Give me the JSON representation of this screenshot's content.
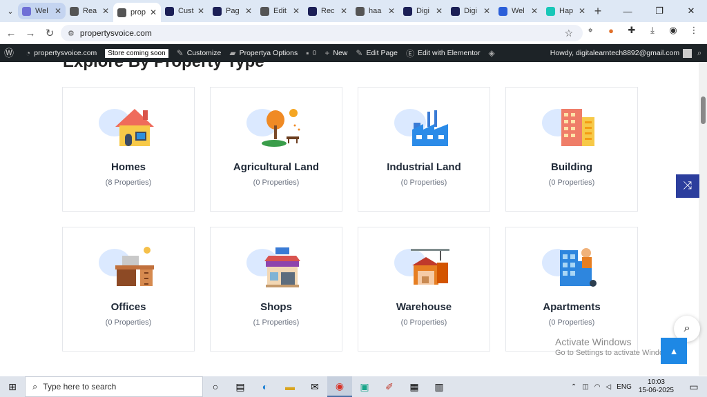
{
  "browser": {
    "tabs": [
      {
        "title": "Wel",
        "color": "#6f6fd6",
        "active": false,
        "highlight": true
      },
      {
        "title": "Rea",
        "color": "#555555",
        "active": false,
        "highlight": false
      },
      {
        "title": "prop",
        "color": "#555555",
        "active": true,
        "highlight": false
      },
      {
        "title": "Cust",
        "color": "#1b1f56",
        "active": false,
        "highlight": false
      },
      {
        "title": "Pag",
        "color": "#1b1f56",
        "active": false,
        "highlight": false
      },
      {
        "title": "Edit",
        "color": "#555555",
        "active": false,
        "highlight": false
      },
      {
        "title": "Rec",
        "color": "#1b1f56",
        "active": false,
        "highlight": false
      },
      {
        "title": "haa",
        "color": "#555555",
        "active": false,
        "highlight": false
      },
      {
        "title": "Digi",
        "color": "#1b1f56",
        "active": false,
        "highlight": false
      },
      {
        "title": "Digi",
        "color": "#1b1f56",
        "active": false,
        "highlight": false
      },
      {
        "title": "Wel",
        "color": "#2b5fd9",
        "active": false,
        "highlight": false
      },
      {
        "title": "Hap",
        "color": "#18c7b8",
        "active": false,
        "highlight": false
      }
    ],
    "address": "propertysvoice.com"
  },
  "adminbar": {
    "site": "propertysvoice.com",
    "store_badge": "Store coming soon",
    "customize": "Customize",
    "options": "Propertya Options",
    "comments": "0",
    "new": "New",
    "edit_page": "Edit Page",
    "elementor": "Edit with Elementor",
    "howdy": "Howdy, digitalearntech8892@gmail.com"
  },
  "section": {
    "heading": "Explore By Property Type"
  },
  "categories": [
    {
      "name": "Homes",
      "count": "(8 Properties)",
      "icon": "house-icon"
    },
    {
      "name": "Agricultural Land",
      "count": "(0 Properties)",
      "icon": "tree-icon"
    },
    {
      "name": "Industrial Land",
      "count": "(0 Properties)",
      "icon": "factory-icon"
    },
    {
      "name": "Building",
      "count": "(0 Properties)",
      "icon": "building-icon"
    },
    {
      "name": "Offices",
      "count": "(0 Properties)",
      "icon": "desk-icon"
    },
    {
      "name": "Shops",
      "count": "(1 Properties)",
      "icon": "shop-icon"
    },
    {
      "name": "Warehouse",
      "count": "(0 Properties)",
      "icon": "warehouse-icon"
    },
    {
      "name": "Apartments",
      "count": "(0 Properties)",
      "icon": "apartment-icon"
    }
  ],
  "watermark": {
    "line1": "Activate Windows",
    "line2": "Go to Settings to activate Windows."
  },
  "taskbar": {
    "search_placeholder": "Type here to search",
    "lang": "ENG",
    "time": "10:03",
    "date": "15-06-2025"
  }
}
